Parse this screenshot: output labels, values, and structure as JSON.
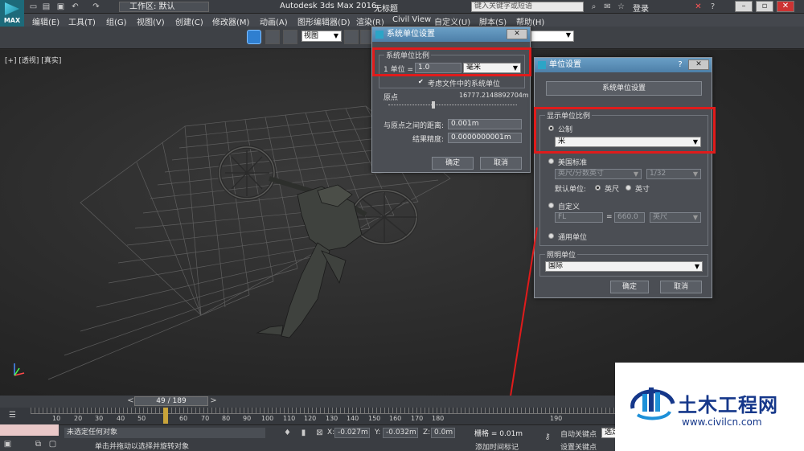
{
  "titlebar": {
    "logo_text": "MAX",
    "workspace": "工作区: 默认",
    "app_title": "Autodesk 3ds Max 2016",
    "doc_title": "无标题",
    "search_placeholder": "键入关键字或短语",
    "login": "登录"
  },
  "menu": [
    "编辑(E)",
    "工具(T)",
    "组(G)",
    "视图(V)",
    "创建(C)",
    "修改器(M)",
    "动画(A)",
    "图形编辑器(D)",
    "渲染(R)",
    "Civil View",
    "自定义(U)",
    "脚本(S)",
    "帮助(H)"
  ],
  "toolbar": {
    "view_select": "视图"
  },
  "viewport": {
    "label": "[+] [透视] [真实]"
  },
  "system_units_dialog": {
    "title": "系统单位设置",
    "group_label": "系统单位比例",
    "unit_prefix": "1 单位 =",
    "unit_value": "1.0",
    "unit_select": "毫米",
    "consider_file_units": "考虑文件中的系统单位",
    "origin_label": "原点",
    "origin_value": "16777.2148892704m",
    "distance_label": "与原点之间的距离:",
    "distance_value": "0.001m",
    "precision_label": "结果精度:",
    "precision_value": "0.0000000001m",
    "ok": "确定",
    "cancel": "取消"
  },
  "units_setup_dialog": {
    "title": "单位设置",
    "system_units_button": "系统单位设置",
    "display_scale_label": "显示单位比例",
    "metric_label": "公制",
    "metric_select": "米",
    "us_standard_label": "美国标准",
    "us_select": "英尺/分数英寸",
    "fraction_select": "1/32",
    "default_units_label": "默认单位:",
    "feet_label": "英尺",
    "inches_label": "英寸",
    "custom_label": "自定义",
    "custom_name": "FL",
    "custom_value": "660.0",
    "custom_unit": "英尺",
    "generic_label": "通用单位",
    "lighting_label": "照明单位",
    "lighting_select": "国际",
    "ok": "确定",
    "cancel": "取消"
  },
  "timeline": {
    "slider": "49 / 189",
    "ticks": [
      "10",
      "20",
      "30",
      "40",
      "50",
      "60",
      "70",
      "80",
      "90",
      "100",
      "110",
      "120",
      "130",
      "140",
      "150",
      "160",
      "170",
      "180",
      "190"
    ]
  },
  "statusbar": {
    "message": "未选定任何对象",
    "prompt": "单击并拖动以选择并旋转对象",
    "x_label": "X:",
    "x_value": "-0.027m",
    "y_label": "Y:",
    "y_value": "-0.032m",
    "z_label": "Z:",
    "z_value": "0.0m",
    "grid": "栅格 = 0.01m",
    "add_time_tag": "添加时间标记",
    "auto_key": "自动关键点",
    "set_key": "设置关键点",
    "select_value": "选定"
  },
  "watermark": {
    "name": "土木工程网",
    "url": "www.civilcn.com"
  },
  "colors": {
    "highlight": "#e01b1b",
    "watermark_blue": "#15378a",
    "dialog_bg": "#4b4e54"
  }
}
